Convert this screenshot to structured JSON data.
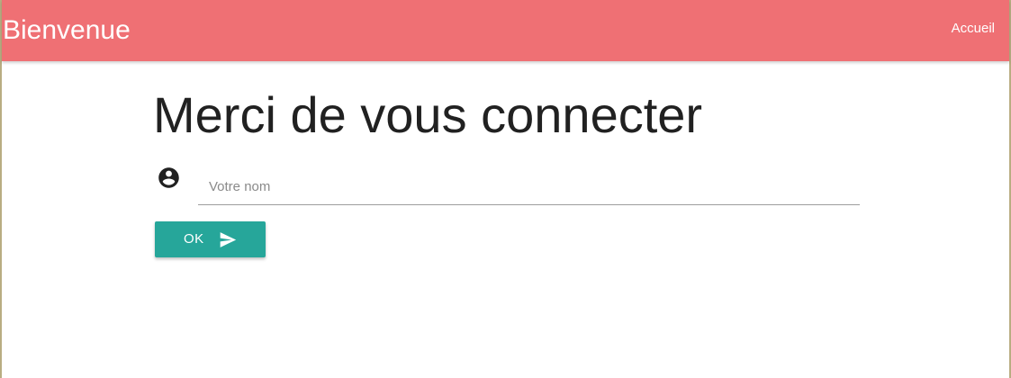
{
  "navbar": {
    "brand": "Bienvenue",
    "links": [
      "Accueil"
    ],
    "background_color": "#ef7074"
  },
  "main": {
    "title": "Merci de vous connecter",
    "name_input": {
      "value": "",
      "placeholder": "Votre nom",
      "icon": "account-circle-icon"
    },
    "submit_button": {
      "label": "OK",
      "icon": "send-icon",
      "color": "#26a69a"
    }
  }
}
